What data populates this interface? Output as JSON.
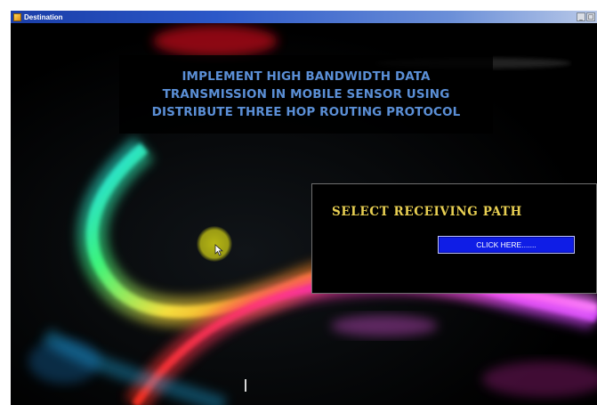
{
  "window": {
    "title": "Destination",
    "controls": {
      "minimize": "_",
      "maximize": "□"
    }
  },
  "heading": {
    "lines": [
      "IMPLEMENT HIGH BANDWIDTH DATA",
      "TRANSMISSION IN MOBILE SENSOR USING",
      "DISTRIBUTE THREE HOP ROUTING PROTOCOL"
    ]
  },
  "panel": {
    "title": "SELECT RECEIVING PATH",
    "button_label": "CLICK HERE......."
  },
  "colors": {
    "heading_text": "#5b8fd6",
    "panel_title": "#e8cf52",
    "button_bg": "#0f1de6",
    "cursor_halo": "#bebe14"
  },
  "icons": {
    "app": "app-icon",
    "pointer": "mouse-pointer-icon"
  }
}
